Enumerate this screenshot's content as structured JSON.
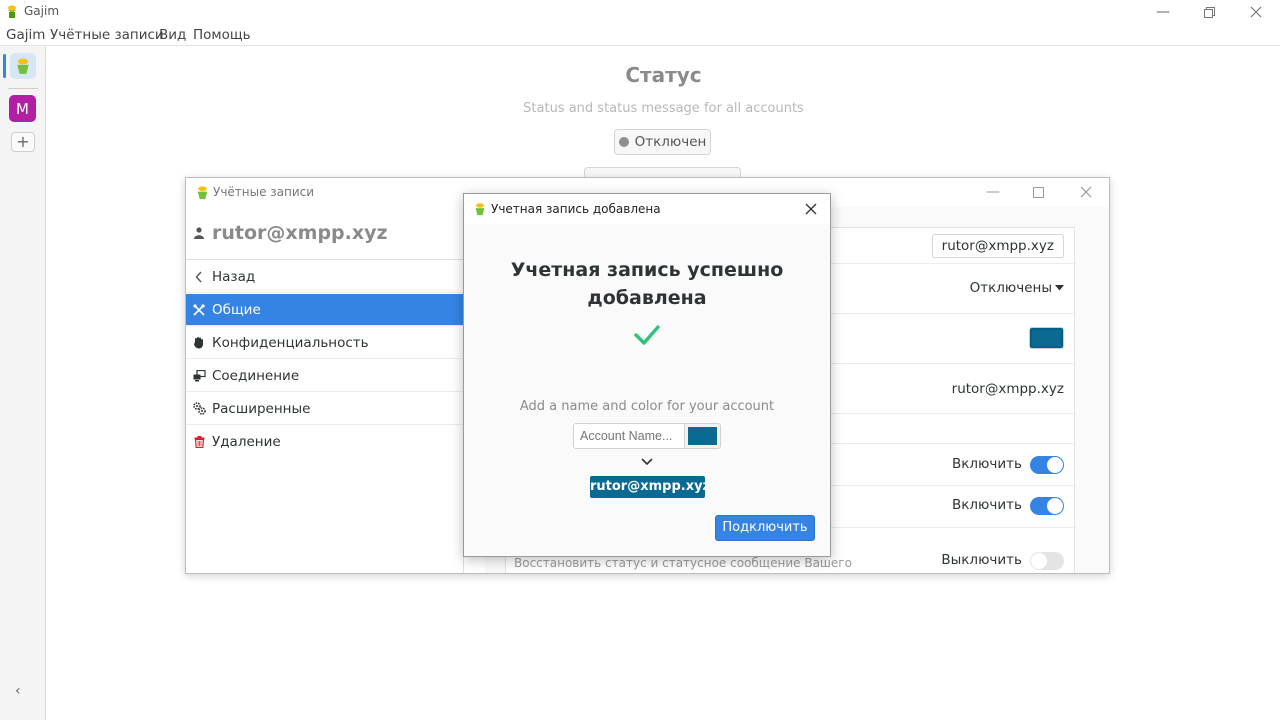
{
  "app": {
    "window_title": "Gajim",
    "menu": [
      "Gajim",
      "Учётные записи",
      "Вид",
      "Помощь"
    ]
  },
  "sidebar": {
    "account_letter": "M",
    "add_symbol": "+",
    "collapse_symbol": "‹"
  },
  "status": {
    "title": "Статус",
    "subtitle": "Status and status message for all accounts",
    "button_label": "Отключен"
  },
  "accounts_window": {
    "title": "Учётные записи",
    "jid": "rutor@xmpp.xyz",
    "nav": [
      {
        "label": "Назад",
        "icon": "chevron-left-icon"
      },
      {
        "label": "Общие",
        "icon": "tools-icon"
      },
      {
        "label": "Конфиденциальность",
        "icon": "hand-icon"
      },
      {
        "label": "Соединение",
        "icon": "network-icon"
      },
      {
        "label": "Расширенные",
        "icon": "gears-icon"
      },
      {
        "label": "Удаление",
        "icon": "trash-icon"
      }
    ],
    "settings": {
      "name_value": "rutor@xmpp.xyz",
      "status_value": "Отключены",
      "jid_value": "rutor@xmpp.xyz",
      "toggle1_label": "Включить",
      "toggle2_label": "Включить",
      "toggle3_label": "Выключить",
      "restore_status_text": "Восстановить статус и статусное сообщение Вашего",
      "color": "#0a6a91"
    }
  },
  "dialog": {
    "title": "Учетная запись добавлена",
    "heading": "Учетная запись успешно добавлена",
    "hint": "Add a name and color for your account",
    "name_placeholder": "Account Name...",
    "jid_badge": "rutor@xmpp.xyz",
    "connect_label": "Подключить",
    "accent_color": "#0a6a91",
    "check_color": "#2ec27e"
  }
}
